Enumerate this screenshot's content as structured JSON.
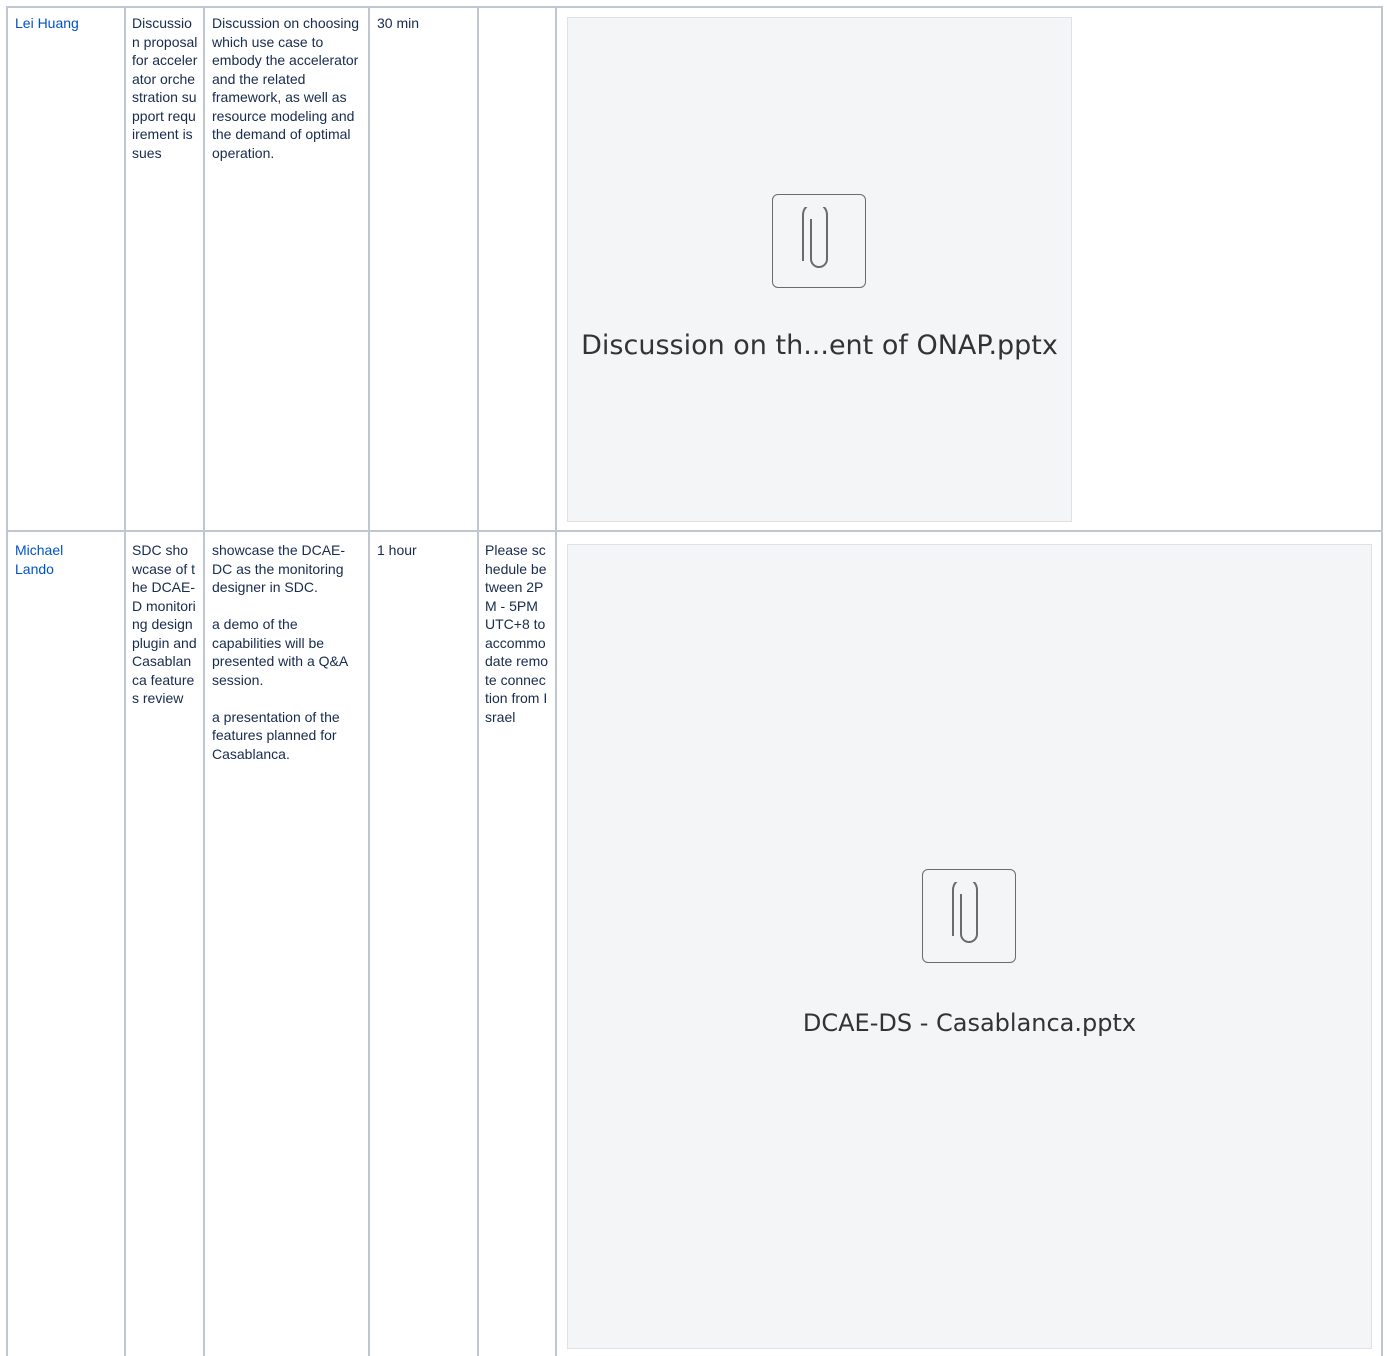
{
  "rows": [
    {
      "presenter": "Lei Huang",
      "topic": "Discussion proposal for accelerator orchestration support requirement issues",
      "description": [
        "Discussion on choosing which use case to embody the accelerator and the related framework, as well as resource modeling and the demand of optimal operation."
      ],
      "duration": "30 min",
      "notes": "",
      "attachment": {
        "filename": "Discussion on th...ent of ONAP.pptx",
        "icon": "paperclip-icon"
      }
    },
    {
      "presenter": "Michael Lando",
      "topic": "SDC showcase of the DCAE-D monitoring design plugin and Casablanca features review",
      "description": [
        "showcase the DCAE-DC as the monitoring designer in SDC.",
        "a demo of the capabilities will be presented with a Q&A session.",
        "a presentation of the features planned for Casablanca."
      ],
      "duration": "1 hour",
      "notes": "Please schedule between 2PM - 5PM UTC+8 to accommodate remote connection from Israel",
      "attachment": {
        "filename": "DCAE-DS - Casablanca.pptx",
        "icon": "paperclip-icon"
      }
    }
  ]
}
